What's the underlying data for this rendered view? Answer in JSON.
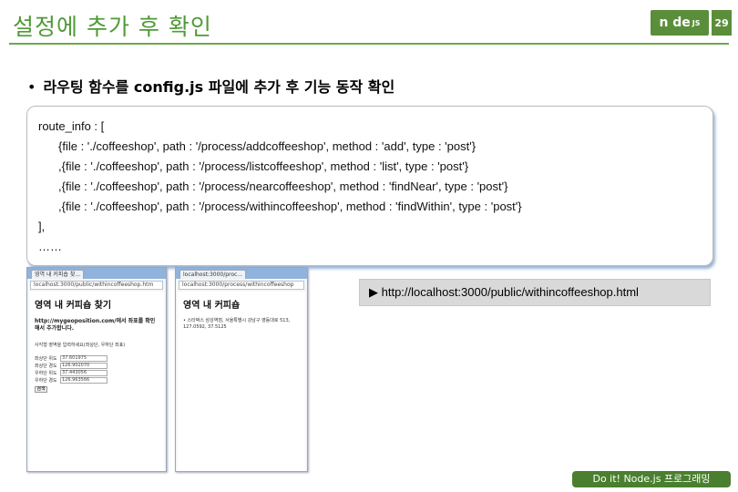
{
  "slide": {
    "title": "설정에 추가 후 확인",
    "page_number": "29",
    "logo_text": "n  de",
    "logo_suffix": "JS",
    "bullet_mark": "•",
    "bullet_text": "라우팅 함수를 config.js 파일에 추가 후 기능 동작 확인",
    "footer": "Do it! Node.js 프로그래밍"
  },
  "code": {
    "lines": [
      "route_info : [",
      "{file : './coffeeshop', path : '/process/addcoffeeshop', method : 'add', type : 'post'}",
      ",{file : './coffeeshop', path : '/process/listcoffeeshop', method : 'list', type : 'post'}",
      ",{file : './coffeeshop', path : '/process/nearcoffeeshop', method : 'findNear', type : 'post'}",
      ",{file : './coffeeshop', path : '/process/withincoffeeshop', method : 'findWithin', type : 'post'}",
      "],",
      "……"
    ]
  },
  "caption": "▶ http://localhost:3000/public/withincoffeeshop.html",
  "browser1": {
    "tab": "영역 내 커피숍 찾...",
    "url": "localhost:3000/public/withincoffeeshop.htm",
    "heading": "영역 내 커피숍 찾기",
    "intro": "http://mygeoposition.com/에서 좌표를 확인해서 추가합니다.",
    "hint": "사각형 영역을 입력하세요(좌상단, 우하단 좌표)",
    "fields": [
      {
        "label": "좌상단 위도",
        "value": "37.601975"
      },
      {
        "label": "좌상단 경도",
        "value": "126.902070"
      },
      {
        "label": "우하단 위도",
        "value": "37.443056"
      },
      {
        "label": "우하단 경도",
        "value": "126.963566"
      }
    ],
    "submit": "검색"
  },
  "browser2": {
    "tab": "localhost:3000/proc...",
    "url": "localhost:3000/process/withincoffeeshop",
    "heading": "영역 내 커피숍",
    "item": "• 스타벅스 삼성역점, 서울특별시 강남구 영동대로 513, 127.0592, 37.5125"
  }
}
